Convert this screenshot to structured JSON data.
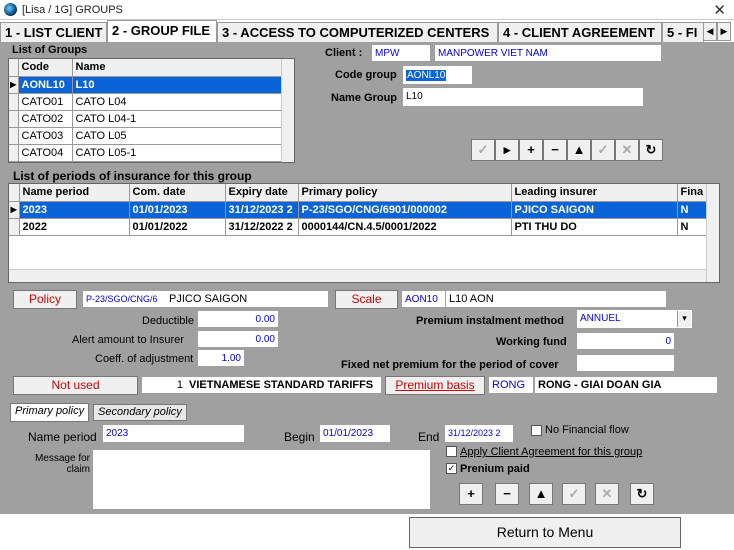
{
  "window": {
    "title": "[Lisa / 1G] GROUPS",
    "close": "✕"
  },
  "tabs": [
    {
      "label": "1 - LIST CLIENT"
    },
    {
      "label": "2 - GROUP FILE"
    },
    {
      "label": "3 - ACCESS TO COMPUTERIZED CENTERS"
    },
    {
      "label": "4 - CLIENT AGREEMENT"
    },
    {
      "label": "5 - FI"
    }
  ],
  "tab_nav": {
    "prev": "◀",
    "next": "▶"
  },
  "groups": {
    "title": "List of Groups",
    "columns": [
      "Code",
      "Name"
    ],
    "rows": [
      {
        "code": "AONL10",
        "name": "L10"
      },
      {
        "code": "CATO01",
        "name": "CATO L04"
      },
      {
        "code": "CATO02",
        "name": "CATO L04-1"
      },
      {
        "code": "CATO03",
        "name": "CATO L05"
      },
      {
        "code": "CATO04",
        "name": "CATO L05-1"
      }
    ]
  },
  "client": {
    "client_label": "Client :",
    "client_code": "MPW",
    "client_name": "MANPOWER VIET NAM",
    "code_group_label": "Code group",
    "code_group": "AONL10",
    "name_group_label": "Name Group",
    "name_group": "L10"
  },
  "toolbar_top": [
    "✓",
    "▸",
    "+",
    "−",
    "▲",
    "✓",
    "✕",
    "↻"
  ],
  "periods": {
    "title": "List of periods of insurance for this group",
    "columns": [
      "Name period",
      "Com. date",
      "Expiry date",
      "Primary policy",
      "Leading insurer",
      "Fina"
    ],
    "rows": [
      {
        "name": "2023",
        "com": "01/01/2023",
        "exp": "31/12/2023 2",
        "policy": "P-23/SGO/CNG/6901/000002",
        "insurer": "PJICO SAIGON",
        "fin": "N"
      },
      {
        "name": "2022",
        "com": "01/01/2022",
        "exp": "31/12/2022 2",
        "policy": "0000144/CN.4.5/0001/2022",
        "insurer": "PTI THU DO",
        "fin": "N"
      }
    ]
  },
  "detail": {
    "policy_btn": "Policy",
    "policy_no": "P-23/SGO/CNG/6",
    "policy_insurer": "PJICO SAIGON",
    "scale_btn": "Scale",
    "scale_code": "AON10",
    "scale_name": "L10 AON",
    "deductible_label": "Deductible",
    "deductible": "0.00",
    "alert_label": "Alert amount to Insurer",
    "alert": "0.00",
    "coeff_label": "Coeff. of adjustment",
    "coeff": "1.00",
    "premium_method_label": "Premium instalment method",
    "premium_method": "ANNUEL",
    "working_fund_label": "Working fund",
    "working_fund": "0",
    "fixed_net_label": "Fixed net premium for the period of cover",
    "fixed_net": "",
    "not_used_btn": "Not used",
    "tariff_no": "1",
    "tariff_name": "VIETNAMESE STANDARD TARIFFS",
    "premium_basis_btn": "Premium basis",
    "premium_basis_code": "RONG",
    "premium_basis_name": "RONG - GIAI DOAN GIA"
  },
  "subtabs": [
    "Primary policy",
    "Secondary policy"
  ],
  "period_form": {
    "name_label": "Name period",
    "name": "2023",
    "begin_label": "Begin",
    "begin": "01/01/2023",
    "end_label": "End",
    "end": "31/12/2023 2",
    "no_financial_label": "No Financial flow",
    "message_label": "Message for claim",
    "apply_label": "Apply Client Agreement for this group",
    "premium_paid_label": "Prenium paid",
    "premium_paid_check": "✓"
  },
  "toolbar_bottom": [
    "+",
    "−",
    "▲",
    "✓",
    "✕",
    "↻"
  ],
  "return_btn": "Return to Menu"
}
